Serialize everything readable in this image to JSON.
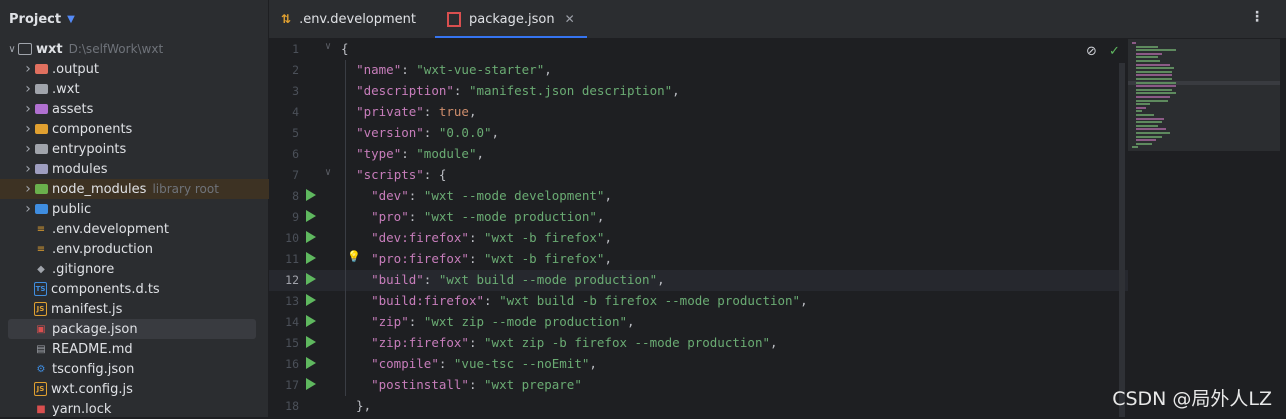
{
  "project_header": {
    "title": "Project",
    "icon": "chevron-down-icon"
  },
  "tree": [
    {
      "label": "wxt",
      "hint": "D:\\selfWork\\wxt",
      "icon": "folder-icon",
      "color": "#a0a4ab"
    },
    {
      "label": ".output",
      "hint": "",
      "icon": "folder-icon",
      "color": "#e0705f"
    },
    {
      "label": ".wxt",
      "hint": "",
      "icon": "folder-icon",
      "color": "#a0a4ab"
    },
    {
      "label": "assets",
      "hint": "",
      "icon": "folder-icon",
      "color": "#b070d0"
    },
    {
      "label": "components",
      "hint": "",
      "icon": "folder-icon",
      "color": "#e0a030"
    },
    {
      "label": "entrypoints",
      "hint": "",
      "icon": "folder-icon",
      "color": "#a0a4ab"
    },
    {
      "label": "modules",
      "hint": "",
      "icon": "folder-icon",
      "color": "#9e9ec0"
    },
    {
      "label": "node_modules",
      "hint": "library root",
      "icon": "folder-icon",
      "color": "#6ab04c"
    },
    {
      "label": "public",
      "hint": "",
      "icon": "folder-icon",
      "color": "#3f8de0"
    },
    {
      "label": ".env.development",
      "hint": "",
      "icon": "env-file-icon",
      "color": "#e0a030"
    },
    {
      "label": ".env.production",
      "hint": "",
      "icon": "env-file-icon",
      "color": "#e0a030"
    },
    {
      "label": ".gitignore",
      "hint": "",
      "icon": "git-icon",
      "color": "#a0a4ab"
    },
    {
      "label": "components.d.ts",
      "hint": "",
      "icon": "ts-file-icon",
      "color": "#3f8de0"
    },
    {
      "label": "manifest.js",
      "hint": "",
      "icon": "js-file-icon",
      "color": "#e0a030"
    },
    {
      "label": "package.json",
      "hint": "",
      "icon": "npm-file-icon",
      "color": "#d94f4f"
    },
    {
      "label": "README.md",
      "hint": "",
      "icon": "markdown-file-icon",
      "color": "#a0a4ab"
    },
    {
      "label": "tsconfig.json",
      "hint": "",
      "icon": "gear-icon",
      "color": "#3f8de0"
    },
    {
      "label": "wxt.config.js",
      "hint": "",
      "icon": "js-file-icon",
      "color": "#e0a030"
    },
    {
      "label": "yarn.lock",
      "hint": "",
      "icon": "lock-icon",
      "color": "#d94f4f"
    }
  ],
  "tabs": [
    {
      "label": ".env.development",
      "icon": "env-file-icon"
    },
    {
      "label": "package.json",
      "icon": "npm-file-icon",
      "active": true
    }
  ],
  "menu_icon": "kebab-menu-icon",
  "editor": {
    "current_line": 12,
    "lines": [
      {
        "n": "1",
        "text": "{"
      },
      {
        "n": "2",
        "text": "  \"name\": \"wxt-vue-starter\","
      },
      {
        "n": "3",
        "text": "  \"description\": \"manifest.json description\","
      },
      {
        "n": "4",
        "text": "  \"private\": true,"
      },
      {
        "n": "5",
        "text": "  \"version\": \"0.0.0\","
      },
      {
        "n": "6",
        "text": "  \"type\": \"module\","
      },
      {
        "n": "7",
        "text": "  \"scripts\": {"
      },
      {
        "n": "8",
        "text": "    \"dev\": \"wxt --mode development\","
      },
      {
        "n": "9",
        "text": "    \"pro\": \"wxt --mode production\","
      },
      {
        "n": "10",
        "text": "    \"dev:firefox\": \"wxt -b firefox\","
      },
      {
        "n": "11",
        "text": "    \"pro:firefox\": \"wxt -b firefox\","
      },
      {
        "n": "12",
        "text": "    \"build\": \"wxt build --mode production\","
      },
      {
        "n": "13",
        "text": "    \"build:firefox\": \"wxt build -b firefox --mode production\","
      },
      {
        "n": "14",
        "text": "    \"zip\": \"wxt zip --mode production\","
      },
      {
        "n": "15",
        "text": "    \"zip:firefox\": \"wxt zip -b firefox --mode production\","
      },
      {
        "n": "16",
        "text": "    \"compile\": \"vue-tsc --noEmit\","
      },
      {
        "n": "17",
        "text": "    \"postinstall\": \"wxt prepare\""
      },
      {
        "n": "18",
        "text": "  },"
      }
    ]
  },
  "watermark": "CSDN @局外人LZ"
}
